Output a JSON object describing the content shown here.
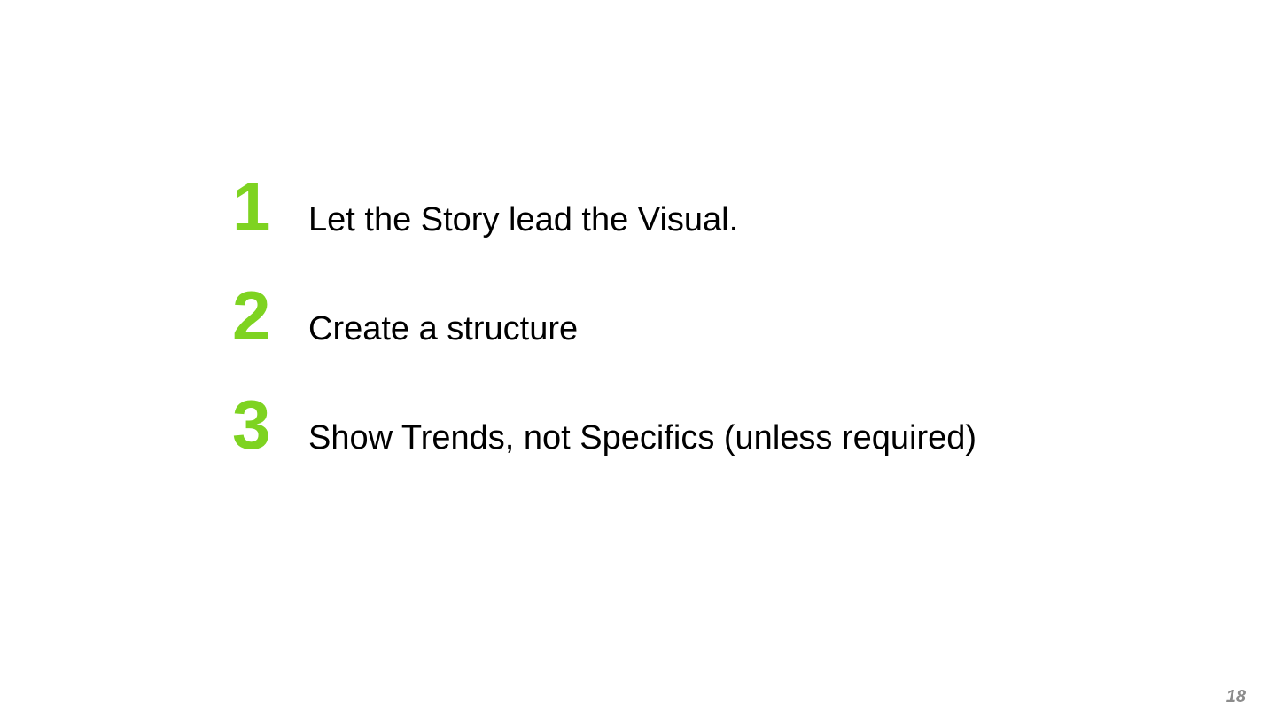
{
  "slide": {
    "accent_color": "#7ed321",
    "text_color": "#000000",
    "items": [
      {
        "number": "1",
        "text": "Let the Story lead the Visual."
      },
      {
        "number": "2",
        "text": "Create a structure"
      },
      {
        "number": "3",
        "text": "Show Trends, not Specifics (unless required)"
      }
    ],
    "page_number": "18"
  }
}
